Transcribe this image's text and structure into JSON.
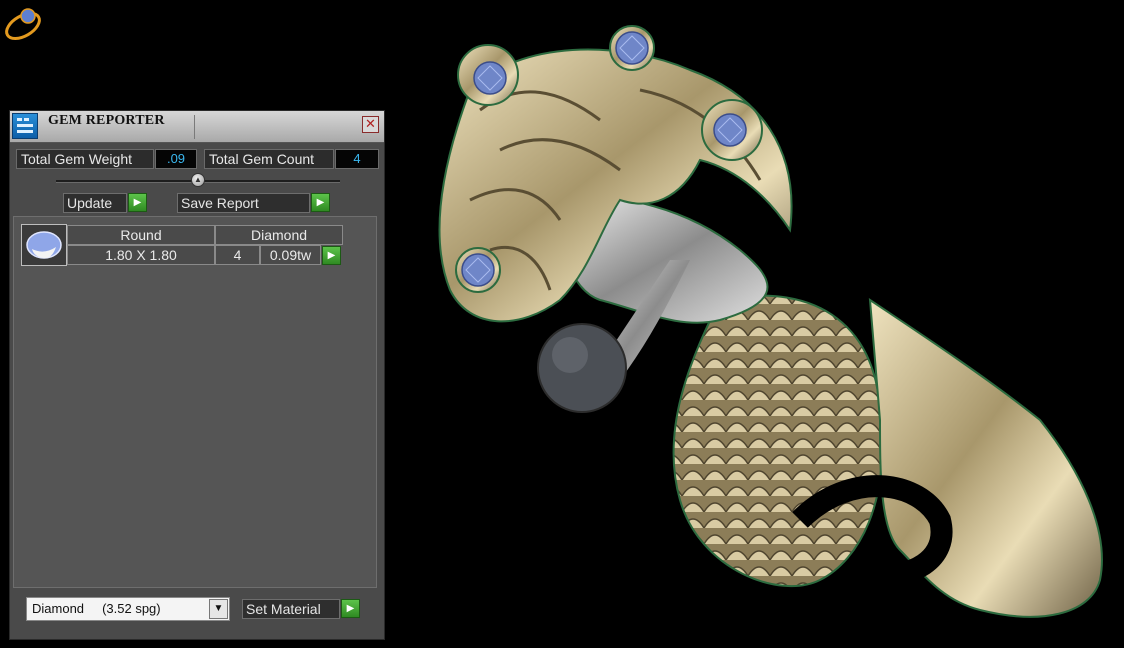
{
  "panel": {
    "title": "GEM REPORTER",
    "close_glyph": "✕",
    "total_weight_label": "Total Gem Weight",
    "total_weight_value": ".09",
    "total_count_label": "Total Gem Count",
    "total_count_value": "4",
    "update_label": "Update",
    "save_report_label": "Save Report",
    "go_glyph": "▶",
    "gem_rows": [
      {
        "shape": "Round",
        "material": "Diamond",
        "size": "1.80 X 1.80",
        "count": "4",
        "weight": "0.09tw"
      }
    ],
    "material_selected": "Diamond     (3.52 spg)",
    "set_material_label": "Set Material",
    "dropdown_glyph": "▼"
  },
  "icons": {
    "app": "gem-reporter-icon",
    "close": "close-icon",
    "go": "play-arrow-icon",
    "gem": "round-gem-icon",
    "gizmo": "ring-orientation-icon"
  },
  "colors": {
    "metal": "#c9b98e",
    "gem_blue": "#6f86c8",
    "accent_green": "#3aa52a",
    "value_cyan": "#3ab8f0"
  }
}
